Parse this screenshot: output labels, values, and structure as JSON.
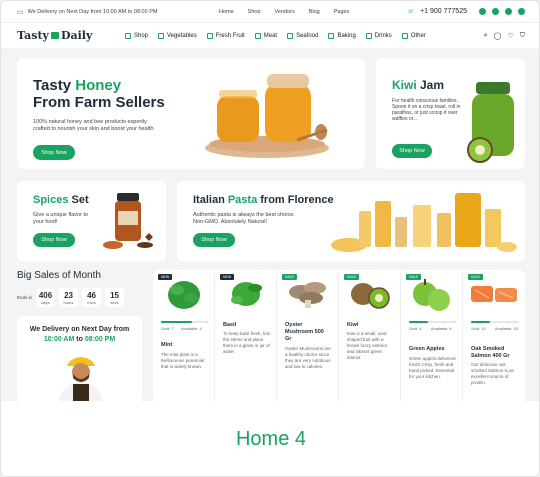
{
  "topbar": {
    "delivery": "We Delivery on Next Day from 10:00 AM to 08:00 PM",
    "nav": [
      "Home",
      "Shop",
      "Vendors",
      "Blog",
      "Pages"
    ],
    "phone": "+1 900 777525"
  },
  "header": {
    "logo_a": "Tasty",
    "logo_b": "Daily",
    "categories": [
      "Shop",
      "Vegetables",
      "Fresh Fruit",
      "Meat",
      "Seafood",
      "Baking",
      "Drinks",
      "Other"
    ]
  },
  "hero": {
    "title_a": "Tasty ",
    "title_b": "Honey",
    "title_c": "From Farm Sellers",
    "desc": "100% natural honey and bee products expertly crafted to nourish your skin and boost your health.",
    "cta": "Shop Now"
  },
  "kiwi": {
    "title_a": "Kiwi",
    "title_b": " Jam",
    "desc": "For health conscious families. Spoon it on a crisp toast, roll in parathas, or just scoop it over waffles or...",
    "cta": "Shop Now"
  },
  "spices": {
    "title_a": "Spices",
    "title_b": " Set",
    "desc": "Give a unique flavor to your food!",
    "cta": "Shop Now"
  },
  "pasta": {
    "title_a": "Italian ",
    "title_b": "Pasta",
    "title_c": " from Florence",
    "desc": "Authentic pasta is always the best choice. Non-GMO. Absolutely Natural!",
    "cta": "Shop Now"
  },
  "sales": {
    "title": "Big Sales of Month",
    "ends_label": "Ends in",
    "days": "406",
    "days_label": "days",
    "hours": "23",
    "hours_label": "hours",
    "mins": "46",
    "mins_label": "mins",
    "secs": "15",
    "secs_label": "secs"
  },
  "delivery_card": {
    "line1": "We Delivery on Next Day from",
    "time_a": "10:00 AM",
    "to": " to ",
    "time_b": "08:00 PM"
  },
  "products": [
    {
      "badge": "NEW",
      "name": "Mint",
      "sold": "Sold: 7",
      "avail": "Available: 4",
      "desc": "The mint plant is a herbaceous perennial that is widely known.",
      "fill": 0.64
    },
    {
      "badge": "NEW",
      "name": "Basil",
      "sold": "",
      "avail": "",
      "desc": "To keep basil fresh, trim the stems and place them in a glass or jar of water.",
      "fill": 0
    },
    {
      "badge": "SALE",
      "name": "Oyster Mushroom 500 Gr",
      "sold": "",
      "avail": "",
      "desc": "Oyster Mushrooms are a healthy choice since they are very nutritious and low in calories.",
      "fill": 0
    },
    {
      "badge": "SALE",
      "name": "Kiwi",
      "sold": "",
      "avail": "",
      "desc": "Kiwi is a small, oval-shaped fruit with a brown fuzzy exterior and vibrant green interior.",
      "fill": 0
    },
    {
      "badge": "SALE",
      "name": "Green Apples",
      "sold": "Sold: 4",
      "avail": "Available: 6",
      "desc": "Green apples delivered fresh! Crisp, fresh and hand picked. Essential for your kitchen.",
      "fill": 0.4
    },
    {
      "badge": "SALE",
      "name": "Oak Smoked Salmon 400 Gr",
      "sold": "Sold: 10",
      "avail": "Available: 15",
      "desc": "Our delicious oak smoked Salmon is an excellent source of protein.",
      "fill": 0.4
    }
  ],
  "footer_label": "Home 4",
  "colors": {
    "accent": "#1aa260",
    "dark": "#1e2d3b"
  }
}
